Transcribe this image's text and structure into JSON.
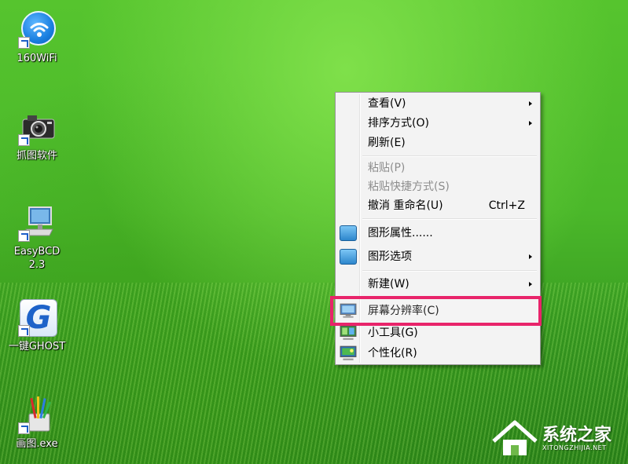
{
  "desktop": {
    "icons": [
      {
        "label": "160WiFi",
        "icon": "wifi-icon"
      },
      {
        "label": "抓图软件",
        "icon": "camera-icon"
      },
      {
        "label": "EasyBCD\n2.3",
        "label_line1": "EasyBCD",
        "label_line2": "2.3",
        "icon": "computer-icon"
      },
      {
        "label": "一键GHOST",
        "icon": "ghost-g-icon",
        "glyph": "G"
      },
      {
        "label": "画图.exe",
        "icon": "paint-brushes-icon"
      }
    ]
  },
  "context_menu": {
    "items": [
      {
        "label": "查看(V)",
        "submenu": true
      },
      {
        "label": "排序方式(O)",
        "submenu": true
      },
      {
        "label": "刷新(E)"
      },
      {
        "label": "粘贴(P)",
        "disabled": true
      },
      {
        "label": "粘贴快捷方式(S)",
        "disabled": true
      },
      {
        "label": "撤消 重命名(U)",
        "shortcut": "Ctrl+Z"
      },
      {
        "label": "图形属性......",
        "icon": "graphics-icon"
      },
      {
        "label": "图形选项",
        "icon": "graphics-icon",
        "submenu": true
      },
      {
        "label": "新建(W)",
        "submenu": true
      },
      {
        "label": "屏幕分辨率(C)",
        "icon": "display-icon",
        "highlighted": true
      },
      {
        "label": "小工具(G)",
        "icon": "gadgets-icon"
      },
      {
        "label": "个性化(R)",
        "icon": "personalize-icon"
      }
    ]
  },
  "watermark": {
    "title": "系统之家",
    "subtitle": "XITONGZHIJIA.NET"
  },
  "colors": {
    "highlight_box": "#e8246a",
    "desktop_green": "#4bb82a"
  }
}
